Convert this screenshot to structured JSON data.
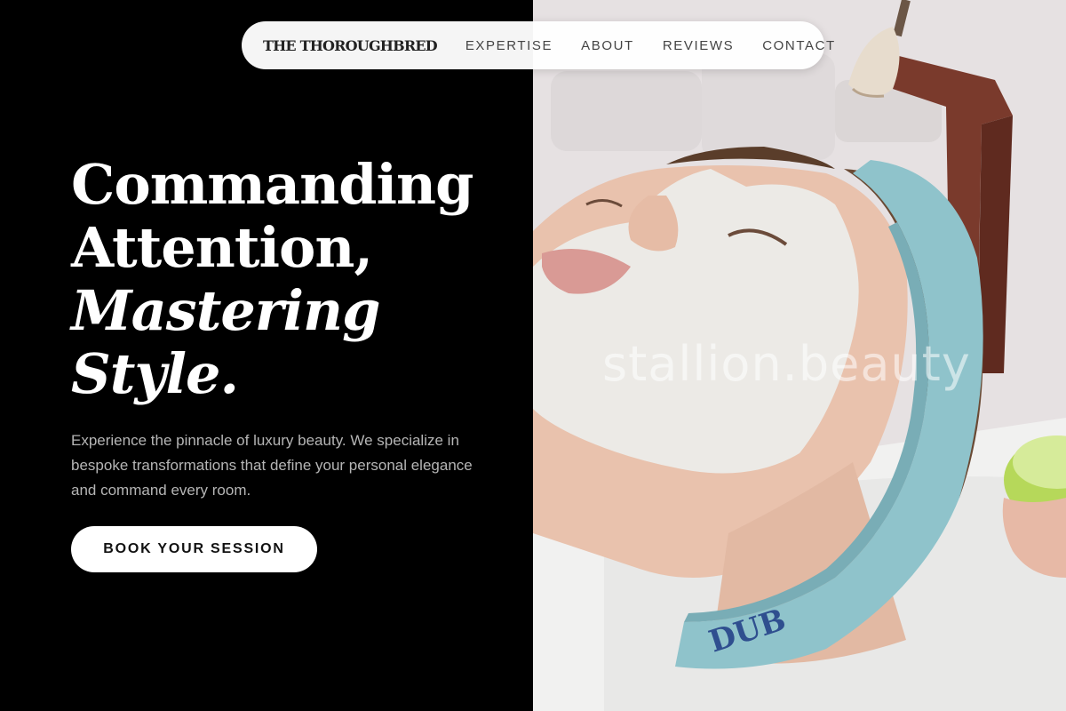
{
  "nav": {
    "brand": "THE THOROUGHBRED",
    "links": [
      "EXPERTISE",
      "ABOUT",
      "REVIEWS",
      "CONTACT"
    ]
  },
  "hero": {
    "headline_line1": "Commanding",
    "headline_line2": "Attention,",
    "headline_line3": "Mastering",
    "headline_line4": "Style.",
    "subtitle": "Experience the pinnacle of luxury beauty. We specialize in bespoke transformations that define your personal elegance and command every room.",
    "cta_label": "BOOK YOUR SESSION"
  },
  "image": {
    "watermark": "stallion.beauty",
    "headband_text": "DUB"
  },
  "colors": {
    "background": "#000000",
    "text_primary": "#ffffff",
    "text_secondary": "#b5b5b5",
    "nav_bg": "#ffffff",
    "headband": "#8fc3cb",
    "mask": "#ecebe8",
    "bowl": "#b6d85a"
  }
}
